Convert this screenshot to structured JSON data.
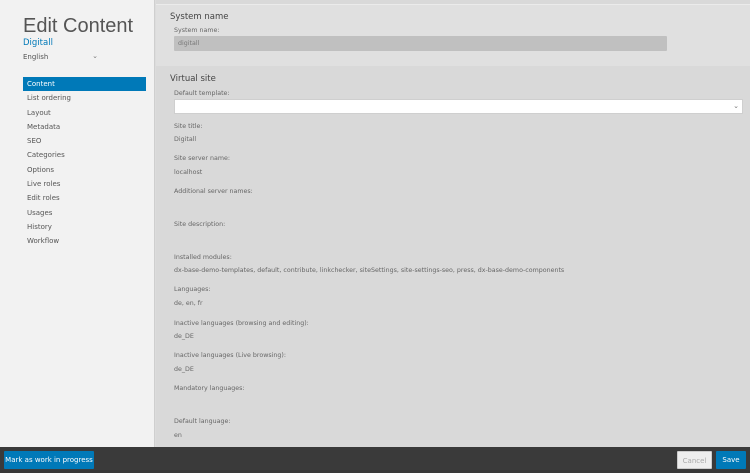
{
  "sidebar": {
    "title": "Edit Content",
    "subtitle": "Digitall",
    "language": "English",
    "nav": [
      "Content",
      "List ordering",
      "Layout",
      "Metadata",
      "SEO",
      "Categories",
      "Options",
      "Live roles",
      "Edit roles",
      "Usages",
      "History",
      "Workflow"
    ],
    "active_nav": "Content"
  },
  "system_name_section": {
    "title": "System name",
    "label": "System name:",
    "value": "digitall"
  },
  "virtual_site_section": {
    "title": "Virtual site",
    "default_template_label": "Default template:",
    "default_template_value": "",
    "site_title_label": "Site title:",
    "site_title_value": "Digitall",
    "server_name_label": "Site server name:",
    "server_name_value": "localhost",
    "additional_server_names_label": "Additional server names:",
    "site_description_label": "Site description:",
    "installed_modules_label": "Installed modules:",
    "installed_modules_value": "dx-base-demo-templates, default, contribute, linkchecker, siteSettings, site-settings-seo, press, dx-base-demo-components",
    "languages_label": "Languages:",
    "languages_value": "de, en, fr",
    "inactive_languages_edit_label": "Inactive languages (browsing and editing):",
    "inactive_languages_edit_value": "de_DE",
    "inactive_languages_live_label": "Inactive languages (Live browsing):",
    "inactive_languages_live_value": "de_DE",
    "mandatory_languages_label": "Mandatory languages:",
    "default_language_label": "Default language:",
    "default_language_value": "en"
  },
  "footer": {
    "wip_label": "Mark as work in progress",
    "cancel_label": "Cancel",
    "save_label": "Save"
  },
  "colors": {
    "accent": "#0079b8",
    "bottom_bar": "#3a3a3a"
  }
}
